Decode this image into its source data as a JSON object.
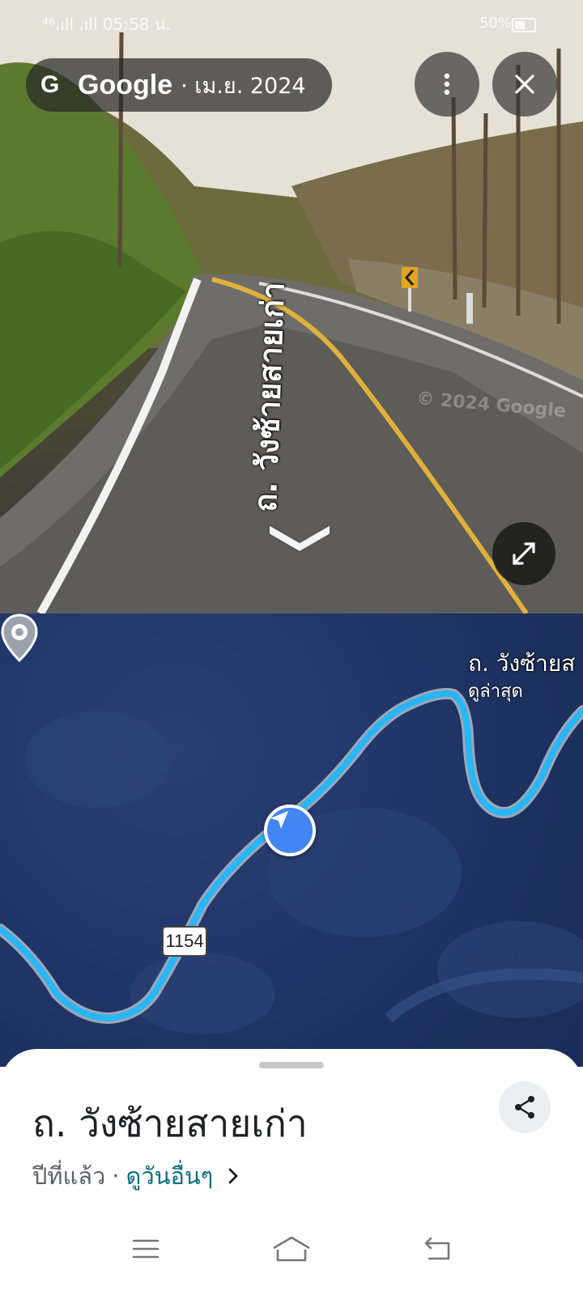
{
  "status_bar": {
    "left_text": "⁴⁶.ıll .ıll 05:58 น.",
    "battery": "50%"
  },
  "streetview": {
    "provider_name": "Google",
    "capture_date": "· เม.ย. 2024",
    "road_overlay_label": "ถ. วังซ้ายสายเก่า",
    "watermark": "© 2024 Google",
    "icons": {
      "more": "more-vert-icon",
      "close": "close-icon",
      "expand": "expand-icon",
      "collapse": "chevron-down-icon"
    }
  },
  "map": {
    "route_number": "1154",
    "pin_title": "ถ. วังซ้ายส",
    "pin_subtitle": "ดูล่าสุด",
    "colors": {
      "route": "#29b6f6",
      "satellite": "#22376a",
      "location": "#4285f4"
    }
  },
  "sheet": {
    "title": "ถ. วังซ้ายสายเก่า",
    "time_ago": "ปีที่แล้ว",
    "separator": "·",
    "see_other_dates": "ดูวันอื่นๆ",
    "icons": {
      "share": "share-icon",
      "chevron": "chevron-right-icon"
    }
  },
  "nav_bar": {
    "icons": [
      "menu-icon",
      "home-icon",
      "back-icon"
    ]
  }
}
